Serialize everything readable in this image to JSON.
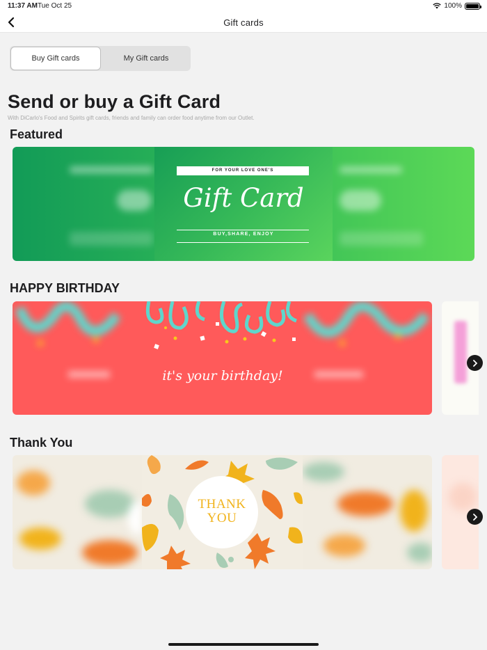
{
  "status_bar": {
    "time": "11:37 AM",
    "date": "Tue Oct 25",
    "battery": "100%",
    "wifi_icon": "wifi-icon"
  },
  "nav": {
    "back_icon": "chevron-left-icon",
    "title": "Gift cards"
  },
  "tabs": [
    {
      "label": "Buy Gift cards",
      "selected": true
    },
    {
      "label": "My Gift cards",
      "selected": false
    }
  ],
  "hero": {
    "title": "Send or buy a Gift Card",
    "subtitle": "With DiCarlo's Food and Spirits gift cards, friends and family can order food anytime from our Outlet."
  },
  "sections": {
    "featured": {
      "title": "Featured",
      "card": {
        "top_line": "FOR YOUR LOVE ONE'S",
        "script": "Gift Card",
        "bottom_line": "BUY,SHARE, ENJOY"
      }
    },
    "birthday": {
      "title": "HAPPY BIRTHDAY",
      "card_text": "it's your birthday!",
      "next_icon": "chevron-right-icon"
    },
    "thank_you": {
      "title": "Thank You",
      "line1": "THANK",
      "line2": "YOU",
      "next_icon": "chevron-right-icon"
    }
  },
  "colors": {
    "featured_green": "#2fb757",
    "birthday_red": "#ff5a5a",
    "confetti_teal": "#5fd6cc",
    "confetti_yellow": "#f7c91c",
    "thankyou_cream": "#f1ece1",
    "thankyou_gold": "#f1b31c"
  }
}
